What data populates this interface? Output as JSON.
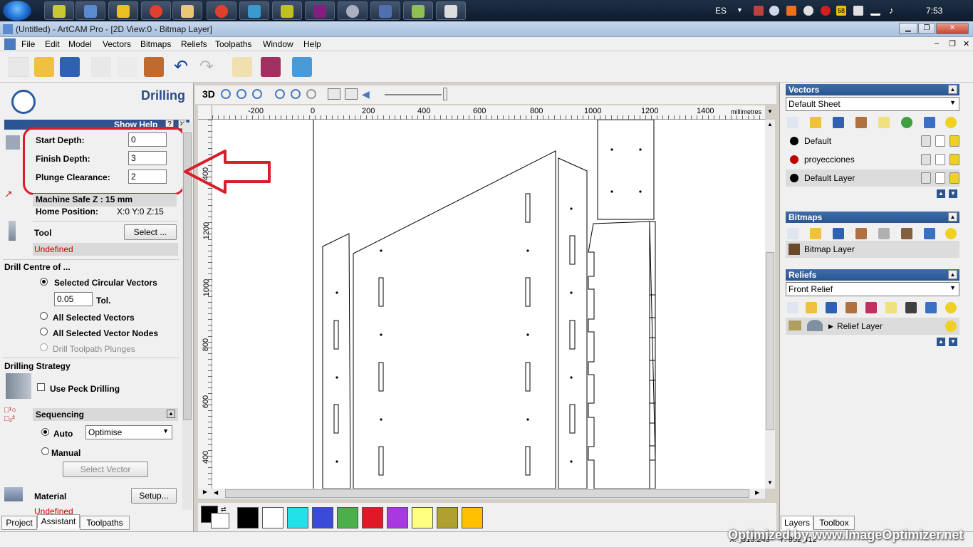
{
  "taskbar": {
    "language": "ES",
    "clock": "7:53",
    "battery": "58"
  },
  "window": {
    "title": "(Untitled) - ArtCAM Pro - [2D View:0 - Bitmap Layer]"
  },
  "menu": [
    "File",
    "Edit",
    "Model",
    "Vectors",
    "Bitmaps",
    "Reliefs",
    "Toolpaths",
    "Window",
    "Help"
  ],
  "left": {
    "title": "Drilling",
    "show_help": "Show Help",
    "start_depth_label": "Start Depth:",
    "start_depth_value": "0",
    "finish_depth_label": "Finish Depth:",
    "finish_depth_value": "3",
    "plunge_label": "Plunge Clearance:",
    "plunge_value": "2",
    "machine_safe": "Machine Safe Z : 15 mm",
    "home_label": "Home Position:",
    "home_value": "X:0 Y:0 Z:15",
    "tool_label": "Tool",
    "select_btn": "Select ...",
    "tool_value": "Undefined",
    "drill_centre": "Drill Centre of ...",
    "opt_circular": "Selected Circular Vectors",
    "tol_value": "0.05",
    "tol_label": "Tol.",
    "opt_all_vectors": "All Selected Vectors",
    "opt_nodes": "All Selected Vector Nodes",
    "opt_plunges": "Drill Toolpath Plunges",
    "strategy": "Drilling Strategy",
    "peck": "Use Peck Drilling",
    "sequencing": "Sequencing",
    "auto": "Auto",
    "optimise": "Optimise",
    "manual": "Manual",
    "select_vector": "Select Vector",
    "material": "Material",
    "setup_btn": "Setup...",
    "material_value": "Undefined"
  },
  "tabs_left": [
    "Project",
    "Assistant",
    "Toolpaths"
  ],
  "view": {
    "mode": "3D",
    "units": "millimetres",
    "ruler_top": [
      "-200",
      "0",
      "200",
      "400",
      "600",
      "800",
      "1000",
      "1200",
      "1400"
    ],
    "ruler_left": [
      "400",
      "1200",
      "1000",
      "800",
      "600",
      "400"
    ]
  },
  "palette": [
    "#000000",
    "#ffffff",
    "#22e0e8",
    "#3a4bd8",
    "#4ab04a",
    "#e01828",
    "#a838e0",
    "#ffff80",
    "#b0a030",
    "#ffc000"
  ],
  "right": {
    "vectors_head": "Vectors",
    "vectors_sheet": "Default Sheet",
    "vector_layers": [
      {
        "name": "Default",
        "color": "#000000"
      },
      {
        "name": "proyecciones",
        "color": "#c00000"
      },
      {
        "name": "Default Layer",
        "color": "#000000"
      }
    ],
    "bitmaps_head": "Bitmaps",
    "bitmap_layer": "Bitmap Layer",
    "reliefs_head": "Reliefs",
    "reliefs_sheet": "Front Relief",
    "relief_layer": "Relief Layer"
  },
  "tabs_right": [
    "Layers",
    "Toolbox"
  ],
  "status": {
    "x": "X: -313.243",
    "y": "Y: 952.412"
  },
  "watermark": "Optimized by www.ImageOptimizer.net"
}
